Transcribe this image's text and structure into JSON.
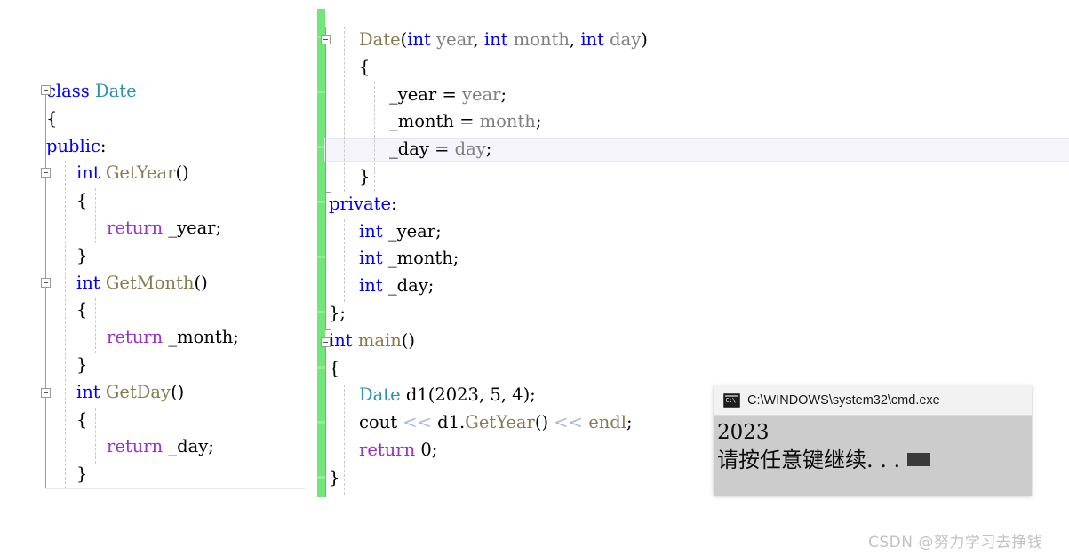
{
  "colors": {
    "keyword": "#0000ff",
    "class_name": "#2b91af",
    "function": "#8a7a50",
    "return_keyword": "#9b30c8",
    "parameter": "#808080",
    "stream_operator": "#a6b8e8",
    "plain_text": "#000000",
    "change_bar_green": "#73e67a",
    "console_background": "#cccccc",
    "console_titlebar": "#f2f2f2",
    "editor_background": "#ffffff",
    "current_line_highlight": "#f4f4fa",
    "watermark": "#c2c2c2"
  },
  "left_pane": {
    "name": "class-declaration-pane",
    "lines": [
      {
        "indent": 0,
        "tokens": [
          {
            "t": "class ",
            "c": "kw"
          },
          {
            "t": "Date",
            "c": "cls"
          }
        ]
      },
      {
        "indent": 0,
        "tokens": [
          {
            "t": "{",
            "c": "pl"
          }
        ]
      },
      {
        "indent": 0,
        "tokens": [
          {
            "t": "public",
            "c": "kw"
          },
          {
            "t": ":",
            "c": "pl"
          }
        ]
      },
      {
        "indent": 1,
        "tokens": [
          {
            "t": "int ",
            "c": "kw"
          },
          {
            "t": "GetYear",
            "c": "fn"
          },
          {
            "t": "()",
            "c": "pl"
          }
        ]
      },
      {
        "indent": 1,
        "tokens": [
          {
            "t": "{",
            "c": "pl"
          }
        ]
      },
      {
        "indent": 2,
        "tokens": [
          {
            "t": "return",
            "c": "ret"
          },
          {
            "t": " _year;",
            "c": "pl"
          }
        ]
      },
      {
        "indent": 1,
        "tokens": [
          {
            "t": "}",
            "c": "pl"
          }
        ]
      },
      {
        "indent": 1,
        "tokens": [
          {
            "t": "int ",
            "c": "kw"
          },
          {
            "t": "GetMonth",
            "c": "fn"
          },
          {
            "t": "()",
            "c": "pl"
          }
        ]
      },
      {
        "indent": 1,
        "tokens": [
          {
            "t": "{",
            "c": "pl"
          }
        ]
      },
      {
        "indent": 2,
        "tokens": [
          {
            "t": "return",
            "c": "ret"
          },
          {
            "t": " _month;",
            "c": "pl"
          }
        ]
      },
      {
        "indent": 1,
        "tokens": [
          {
            "t": "}",
            "c": "pl"
          }
        ]
      },
      {
        "indent": 1,
        "tokens": [
          {
            "t": "int ",
            "c": "kw"
          },
          {
            "t": "GetDay",
            "c": "fn"
          },
          {
            "t": "()",
            "c": "pl"
          }
        ]
      },
      {
        "indent": 1,
        "tokens": [
          {
            "t": "{",
            "c": "pl"
          }
        ]
      },
      {
        "indent": 2,
        "tokens": [
          {
            "t": "return",
            "c": "ret"
          },
          {
            "t": " _day;",
            "c": "pl"
          }
        ]
      },
      {
        "indent": 1,
        "tokens": [
          {
            "t": "}",
            "c": "pl"
          }
        ]
      }
    ],
    "plain_text": "class Date\n{\npublic:\n    int GetYear()\n    {\n        return _year;\n    }\n    int GetMonth()\n    {\n        return _month;\n    }\n    int GetDay()\n    {\n        return _day;\n    }"
  },
  "right_pane": {
    "name": "constructor-and-main-pane",
    "lines": [
      {
        "indent": 1,
        "tokens": [
          {
            "t": "Date",
            "c": "fn"
          },
          {
            "t": "(",
            "c": "pl"
          },
          {
            "t": "int ",
            "c": "kw"
          },
          {
            "t": "year",
            "c": "param"
          },
          {
            "t": ", ",
            "c": "pl"
          },
          {
            "t": "int ",
            "c": "kw"
          },
          {
            "t": "month",
            "c": "param"
          },
          {
            "t": ", ",
            "c": "pl"
          },
          {
            "t": "int ",
            "c": "kw"
          },
          {
            "t": "day",
            "c": "param"
          },
          {
            "t": ")",
            "c": "pl"
          }
        ]
      },
      {
        "indent": 1,
        "tokens": [
          {
            "t": "{",
            "c": "pl"
          }
        ]
      },
      {
        "indent": 2,
        "tokens": [
          {
            "t": "_year = ",
            "c": "pl"
          },
          {
            "t": "year",
            "c": "param"
          },
          {
            "t": ";",
            "c": "pl"
          }
        ]
      },
      {
        "indent": 2,
        "tokens": [
          {
            "t": "_month = ",
            "c": "pl"
          },
          {
            "t": "month",
            "c": "param"
          },
          {
            "t": ";",
            "c": "pl"
          }
        ]
      },
      {
        "indent": 2,
        "tokens": [
          {
            "t": "_day = ",
            "c": "pl"
          },
          {
            "t": "day",
            "c": "param"
          },
          {
            "t": ";",
            "c": "pl"
          }
        ],
        "current": true
      },
      {
        "indent": 1,
        "tokens": [
          {
            "t": "}",
            "c": "pl"
          }
        ]
      },
      {
        "indent": 0,
        "tokens": [
          {
            "t": "private",
            "c": "kw"
          },
          {
            "t": ":",
            "c": "pl"
          }
        ]
      },
      {
        "indent": 1,
        "tokens": [
          {
            "t": "int",
            "c": "kw"
          },
          {
            "t": " _year;",
            "c": "pl"
          }
        ]
      },
      {
        "indent": 1,
        "tokens": [
          {
            "t": "int",
            "c": "kw"
          },
          {
            "t": " _month;",
            "c": "pl"
          }
        ]
      },
      {
        "indent": 1,
        "tokens": [
          {
            "t": "int",
            "c": "kw"
          },
          {
            "t": " _day;",
            "c": "pl"
          }
        ]
      },
      {
        "indent": 0,
        "tokens": [
          {
            "t": "};",
            "c": "pl"
          }
        ]
      },
      {
        "indent": 0,
        "tokens": [
          {
            "t": "int ",
            "c": "kw"
          },
          {
            "t": "main",
            "c": "fn"
          },
          {
            "t": "()",
            "c": "pl"
          }
        ]
      },
      {
        "indent": 0,
        "tokens": [
          {
            "t": "{",
            "c": "pl"
          }
        ]
      },
      {
        "indent": 1,
        "tokens": [
          {
            "t": "Date",
            "c": "cls"
          },
          {
            "t": " d1(2023, 5, 4);",
            "c": "pl"
          }
        ]
      },
      {
        "indent": 1,
        "tokens": [
          {
            "t": "cout ",
            "c": "pl"
          },
          {
            "t": "<<",
            "c": "op"
          },
          {
            "t": " d1.",
            "c": "pl"
          },
          {
            "t": "GetYear",
            "c": "fn"
          },
          {
            "t": "() ",
            "c": "pl"
          },
          {
            "t": "<<",
            "c": "op"
          },
          {
            "t": " ",
            "c": "pl"
          },
          {
            "t": "endl",
            "c": "fn"
          },
          {
            "t": ";",
            "c": "pl"
          }
        ]
      },
      {
        "indent": 1,
        "tokens": [
          {
            "t": "return",
            "c": "ret"
          },
          {
            "t": " 0;",
            "c": "pl"
          }
        ]
      },
      {
        "indent": 0,
        "tokens": [
          {
            "t": "}",
            "c": "pl"
          }
        ]
      }
    ],
    "plain_text": "    Date(int year, int month, int day)\n    {\n        _year = year;\n        _month = month;\n        _day = day;\n    }\nprivate:\n    int _year;\n    int _month;\n    int _day;\n};\nint main()\n{\n    Date d1(2023, 5, 4);\n    cout << d1.GetYear() << endl;\n    return 0;\n}"
  },
  "console": {
    "title": "C:\\WINDOWS\\system32\\cmd.exe",
    "icon": "cmd-terminal-icon",
    "output_lines": [
      "2023",
      "请按任意键继续. . ."
    ],
    "cursor": "block-cursor"
  },
  "watermark": {
    "text": "CSDN @努力学习去挣钱"
  }
}
